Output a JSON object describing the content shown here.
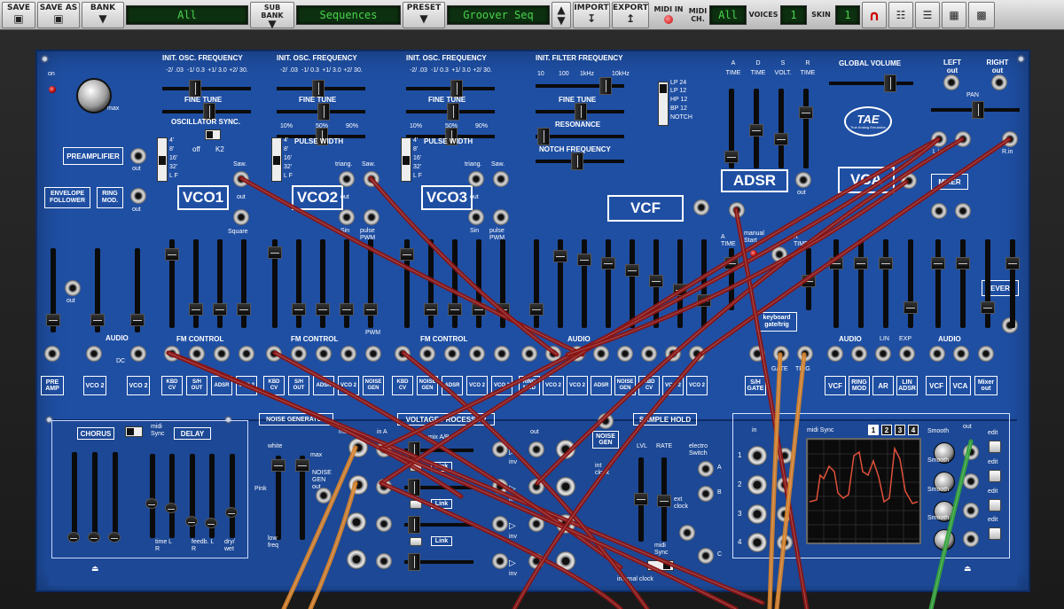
{
  "toolbar": {
    "save_label": "SAVE",
    "save_as_label": "SAVE AS",
    "bank_label": "BANK",
    "bank_value": "All",
    "sub_bank_label": "SUB BANK",
    "sub_bank_value": "Sequences",
    "preset_label": "PRESET",
    "preset_value": "Groover Seq",
    "import_label": "IMPORT",
    "export_label": "EXPORT",
    "midi_in_label": "MIDI IN",
    "midi_ch_label": "MIDI CH.",
    "midi_ch_value": "All",
    "voices_label": "VOICES",
    "voices_value": "1",
    "skin_label": "SKIN",
    "skin_value": "1"
  },
  "modules": {
    "on_label": "on",
    "max_label": "max",
    "preamplifier": "PREAMPLIFIER",
    "envelope_follower": "ENVELOPE FOLLOWER",
    "ring_mod": "RING MOD.",
    "out": "out",
    "audio": "AUDIO",
    "dc": "DC",
    "pre_amp": "PRE AMP",
    "vco_labels": [
      "VCO1",
      "VCO2",
      "VCO3"
    ],
    "init_osc_freq": "INIT. OSC. FREQUENCY",
    "osc_ticks": [
      "-2/ .03",
      "-1/ 0.3",
      "+1/ 3.0",
      "+2/ 30."
    ],
    "fine_tune": "FINE TUNE",
    "oscillator_sync": "OSCILLATOR SYNC.",
    "off": "off",
    "k2": "K2",
    "pulse_width": "PULSE WIDTH",
    "pw_ticks": [
      "10%",
      "50%",
      "90%"
    ],
    "footage": [
      "4'",
      "8'",
      "16'",
      "32'",
      "L F"
    ],
    "saw": "Saw.",
    "square": "Square",
    "triang": "triang.",
    "sin": "Sin",
    "pulse_pwm": "pulse PWM",
    "fm_control": "FM CONTROL",
    "pwm": "PWM",
    "kbd_cv": "KBD CV",
    "sh_out": "S/H OUT",
    "adsr_short": "ADSR",
    "vco_short": "VCO 2",
    "noise_gen": "NOISE GEN",
    "ring_mod_short": "RING MOD",
    "init_filter_freq": "INIT. FILTER FREQUENCY",
    "filter_ticks": [
      "10",
      "100",
      "1kHz",
      "10kHz"
    ],
    "resonance": "RESONANCE",
    "notch_frequency": "NOTCH FREQUENCY",
    "filter_modes": [
      "LP 24",
      "LP 12",
      "HP 12",
      "BP 12",
      "NOTCH"
    ],
    "vcf": "VCF",
    "adsr_params": [
      "A TIME",
      "D TIME",
      "S VOLT.",
      "R TIME"
    ],
    "adsr": "ADSR",
    "ar_params": [
      "A TIME",
      "manual Start",
      "R TIME"
    ],
    "keyboard_gate": "keyboard gate/trig",
    "sh_gate": "S/H GATE",
    "gate": "GATE",
    "trig": "TRIG",
    "global_volume": "GLOBAL VOLUME",
    "tae_logo": "TAE",
    "tae_sub": "True Analog Emulation",
    "vca": "VCA",
    "lin": "LIN",
    "exp": "EXP",
    "ar": "AR",
    "lin_adsr": "LIN ADSR",
    "left_out": "LEFT out",
    "right_out": "RIGHT out",
    "pan": "PAN",
    "l_in": "L.in",
    "r_in": "R.in",
    "mixer": "MIXER",
    "reverb": "REVERB",
    "mixer_out": "Mixer out"
  },
  "lower": {
    "chorus": "CHORUS",
    "delay": "DELAY",
    "midi_sync": "midi Sync",
    "time_lr": "time L R",
    "feedback_lr": "feedb. L R",
    "dry_wet": "dry/ wet",
    "noise_generator": "NOISE GENERATOR",
    "white": "white",
    "pink": "Pink",
    "low_freq": "low freq",
    "noise_gen_out": "NOISE GEN out",
    "max": "max",
    "voltage_processor": "VOLTAGE PROCESSOR",
    "mod_in": "mod in",
    "in_a": "in A",
    "mix_ab": "mix A/B",
    "out": "out",
    "inv": "inv",
    "link": "Link",
    "sample_hold": "SAMPLE HOLD",
    "noise_gen_box": "NOISE GEN",
    "lvl": "LVL",
    "rate": "RATE",
    "int_clock": "int clock",
    "electro_switch": "electro Switch",
    "ext_clock": "ext clock",
    "internal_clock": "internal clock",
    "midi_sync_short": "midi Sync",
    "seq_midi_sync": "midi Sync",
    "seq_steps": [
      "1",
      "2",
      "3",
      "4"
    ],
    "in": "in",
    "smooth": "Smooth",
    "edit": "edit",
    "abc": [
      "A",
      "B",
      "C"
    ]
  },
  "colors": {
    "panel": "#1f4fa3",
    "cable_red": "#8a1414",
    "cable_orange": "#d4812a",
    "cable_green": "#33a23a",
    "lcd_green": "#48d44c",
    "scope_line": "#e0503a"
  }
}
